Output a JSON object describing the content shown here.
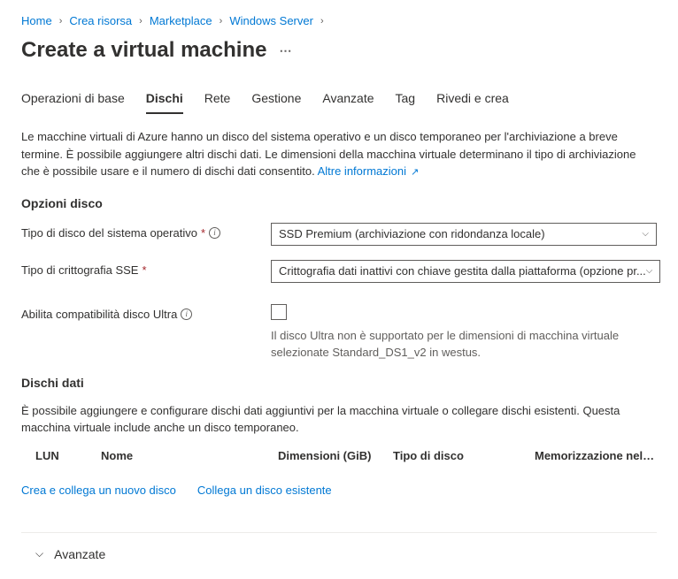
{
  "breadcrumb": {
    "items": [
      "Home",
      "Crea risorsa",
      "Marketplace",
      "Windows Server"
    ]
  },
  "title": "Create a virtual machine",
  "tabs": [
    "Operazioni di base",
    "Dischi",
    "Rete",
    "Gestione",
    "Avanzate",
    "Tag",
    "Rivedi e crea"
  ],
  "activeTabIndex": 1,
  "description": "Le macchine virtuali di Azure hanno un disco del sistema operativo e un disco temporaneo per l'archiviazione a breve termine. È possibile aggiungere altri dischi dati. Le dimensioni della macchina virtuale determinano il tipo di archiviazione che è possibile usare e il numero di dischi dati consentito.",
  "moreInfo": "Altre informazioni",
  "sections": {
    "diskOptions": {
      "heading": "Opzioni disco",
      "osDiskType": {
        "label": "Tipo di disco del sistema operativo",
        "value": "SSD Premium (archiviazione con ridondanza locale)"
      },
      "encryption": {
        "label": "Tipo di crittografia SSE",
        "value": "Crittografia dati inattivi con chiave gestita dalla piattaforma (opzione pr..."
      },
      "ultra": {
        "label": "Abilita compatibilità disco Ultra",
        "hint": "Il disco Ultra non è supportato per le dimensioni di macchina virtuale selezionate Standard_DS1_v2 in westus."
      }
    },
    "dataDisks": {
      "heading": "Dischi dati",
      "text": "È possibile aggiungere e configurare dischi dati aggiuntivi per la macchina virtuale o collegare dischi esistenti. Questa macchina virtuale include anche un disco temporaneo.",
      "columns": {
        "lun": "LUN",
        "nome": "Nome",
        "dim": "Dimensioni (GiB)",
        "tipo": "Tipo di disco",
        "mem": "Memorizzazione nella cache de..."
      },
      "createLink": "Crea e collega un nuovo disco",
      "attachLink": "Collega un disco esistente"
    },
    "advanced": "Avanzate"
  }
}
